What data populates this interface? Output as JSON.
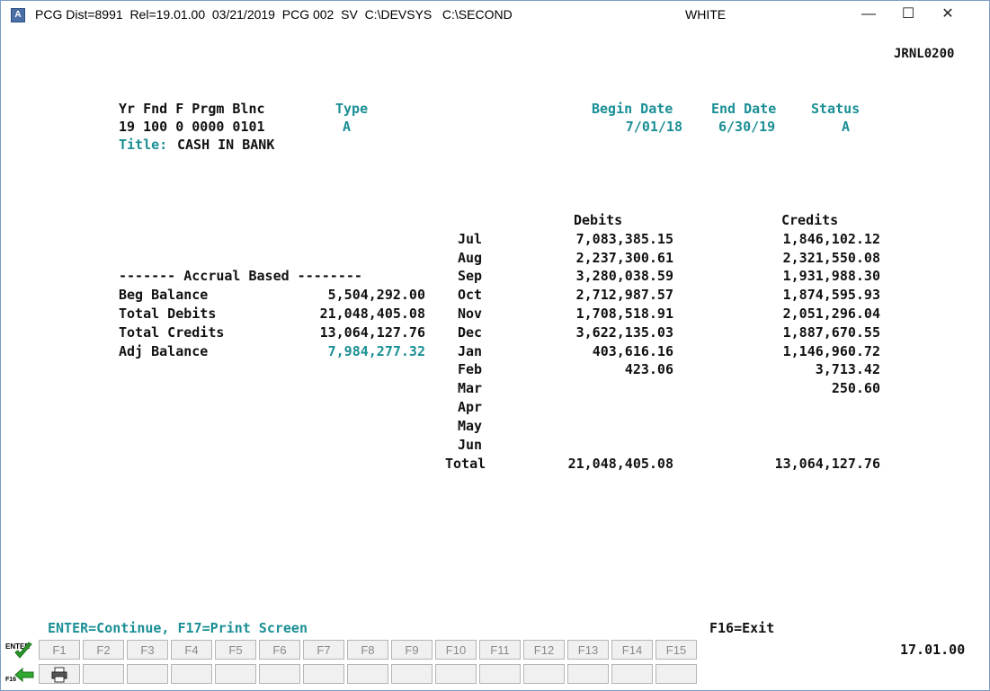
{
  "window": {
    "icon_letter": "A",
    "title": "PCG Dist=8991  Rel=19.01.00  03/21/2019  PCG 002  SV  C:\\DEVSYS   C:\\SECOND",
    "user": "WHITE",
    "minimize": "—",
    "maximize": "☐",
    "close": "✕"
  },
  "screen_id": "JRNL0200",
  "header": {
    "account_label": "Yr Fnd F Prgm Blnc",
    "account_value": "19 100 0 0000 0101",
    "type_label": "Type",
    "type_value": "A",
    "begin_label": "Begin Date",
    "begin_value": "7/01/18",
    "end_label": "End Date",
    "end_value": "6/30/19",
    "status_label": "Status",
    "status_value": "A",
    "title_label": "Title:",
    "title_value": "CASH IN BANK"
  },
  "accrual": {
    "heading": "------- Accrual Based --------",
    "rows": [
      {
        "label": "Beg Balance",
        "value": "5,504,292.00"
      },
      {
        "label": "Total Debits",
        "value": "21,048,405.08"
      },
      {
        "label": "Total Credits",
        "value": "13,064,127.76"
      },
      {
        "label": "Adj Balance",
        "value": "7,984,277.32"
      }
    ]
  },
  "monthly": {
    "debits_header": "Debits",
    "credits_header": "Credits",
    "months": [
      {
        "month": "Jul",
        "debit": "7,083,385.15",
        "credit": "1,846,102.12"
      },
      {
        "month": "Aug",
        "debit": "2,237,300.61",
        "credit": "2,321,550.08"
      },
      {
        "month": "Sep",
        "debit": "3,280,038.59",
        "credit": "1,931,988.30"
      },
      {
        "month": "Oct",
        "debit": "2,712,987.57",
        "credit": "1,874,595.93"
      },
      {
        "month": "Nov",
        "debit": "1,708,518.91",
        "credit": "2,051,296.04"
      },
      {
        "month": "Dec",
        "debit": "3,622,135.03",
        "credit": "1,887,670.55"
      },
      {
        "month": "Jan",
        "debit": "403,616.16",
        "credit": "1,146,960.72"
      },
      {
        "month": "Feb",
        "debit": "423.06",
        "credit": "3,713.42"
      },
      {
        "month": "Mar",
        "debit": "",
        "credit": "250.60"
      },
      {
        "month": "Apr",
        "debit": "",
        "credit": ""
      },
      {
        "month": "May",
        "debit": "",
        "credit": ""
      },
      {
        "month": "Jun",
        "debit": "",
        "credit": ""
      }
    ],
    "total_label": "Total",
    "total_debit": "21,048,405.08",
    "total_credit": "13,064,127.76"
  },
  "footer": {
    "hint_left": "ENTER=Continue, F17=Print Screen",
    "hint_right": "F16=Exit",
    "fkeys": [
      "F1",
      "F2",
      "F3",
      "F4",
      "F5",
      "F6",
      "F7",
      "F8",
      "F9",
      "F10",
      "F11",
      "F12",
      "F13",
      "F14",
      "F15"
    ],
    "enter_key_label": "ENTER",
    "f16_key_label": "F16",
    "version": "17.01.00"
  },
  "colors": {
    "teal": "#1a8f95",
    "text": "#111111"
  }
}
